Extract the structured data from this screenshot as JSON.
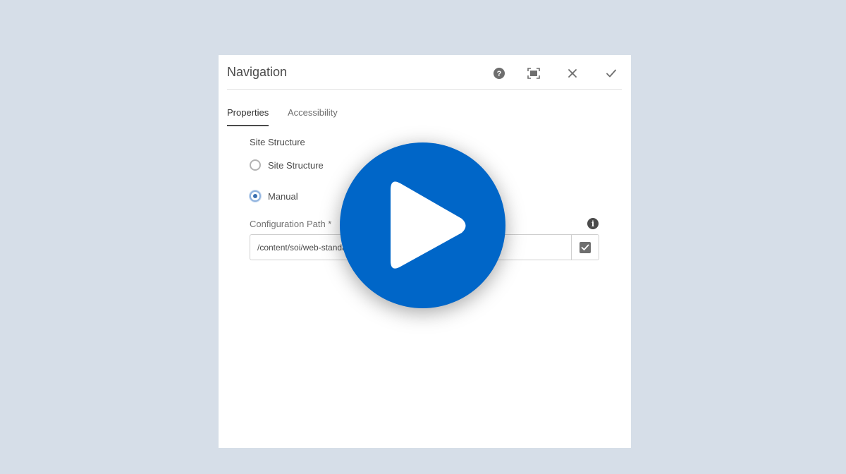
{
  "dialog": {
    "title": "Navigation",
    "header_icons": [
      "help-icon",
      "fullscreen-icon",
      "close-icon",
      "done-icon"
    ]
  },
  "tabs": [
    {
      "label": "Properties",
      "active": true
    },
    {
      "label": "Accessibility",
      "active": false
    }
  ],
  "site_structure": {
    "section_label": "Site Structure",
    "options": [
      {
        "label": "Site Structure",
        "checked": false
      },
      {
        "label": "Manual",
        "checked": true
      }
    ]
  },
  "config_path": {
    "label": "Configuration Path *",
    "value": "/content/soi/web-standards/en/tutorials/creating-a-new-p",
    "info_icon": "info-icon",
    "browse_icon": "checkbox-icon"
  },
  "overlay": {
    "icon": "play-icon",
    "color": "#0066c8"
  }
}
